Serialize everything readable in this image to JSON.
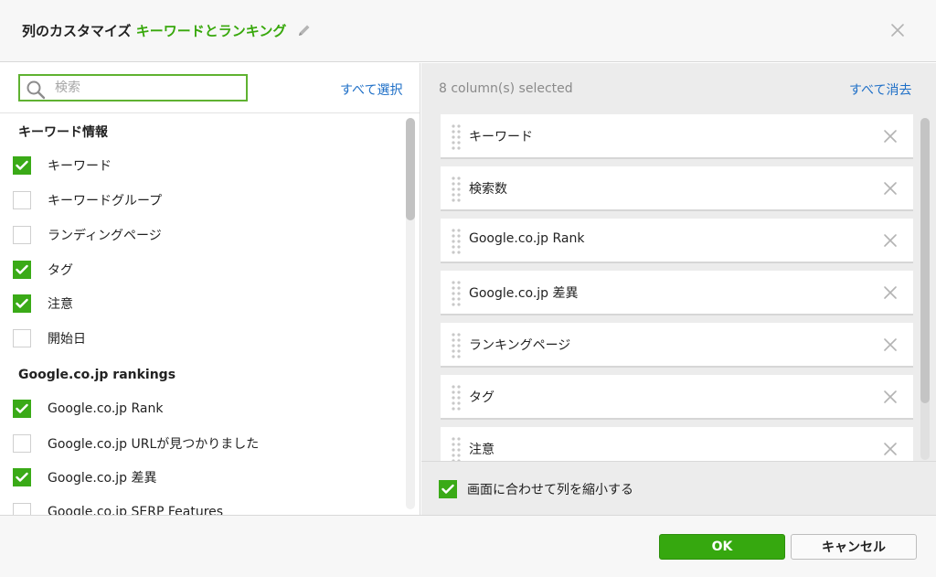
{
  "dialog": {
    "title_prefix": "列のカスタマイズ",
    "title_project": "キーワードとランキング",
    "icons": {
      "edit": "pencil-icon",
      "close": "close-icon"
    }
  },
  "left_panel": {
    "search": {
      "placeholder": "検索",
      "value": "",
      "icon": "search-icon"
    },
    "select_all": "すべて選択",
    "groups": [
      {
        "title": "キーワード情報",
        "options": [
          {
            "label": "キーワード",
            "checked": true
          },
          {
            "label": "キーワードグループ",
            "checked": false
          },
          {
            "label": "ランディングページ",
            "checked": false
          },
          {
            "label": "タグ",
            "checked": true
          },
          {
            "label": "注意",
            "checked": true
          },
          {
            "label": "開始日",
            "checked": false
          }
        ]
      },
      {
        "title": "Google.co.jp rankings",
        "options": [
          {
            "label": "Google.co.jp Rank",
            "checked": true
          },
          {
            "label": "Google.co.jp URLが見つかりました",
            "checked": false
          },
          {
            "label": "Google.co.jp 差異",
            "checked": true
          },
          {
            "label": "Google.co.jp SERP Features",
            "checked": false
          }
        ]
      }
    ]
  },
  "right_panel": {
    "selected_count": "8 column(s) selected",
    "clear_all": "すべて消去",
    "selected": [
      {
        "label": "キーワード"
      },
      {
        "label": "検索数"
      },
      {
        "label": "Google.co.jp Rank"
      },
      {
        "label": "Google.co.jp 差異"
      },
      {
        "label": "ランキングページ"
      },
      {
        "label": "タグ"
      },
      {
        "label": "注意"
      }
    ],
    "fit_to_screen": {
      "label": "画面に合わせて列を縮小する",
      "checked": true
    }
  },
  "footer": {
    "ok": "OK",
    "cancel": "キャンセル"
  },
  "colors": {
    "accent": "#3aaa17",
    "link": "#1e6fc7",
    "panel": "#ececec"
  }
}
